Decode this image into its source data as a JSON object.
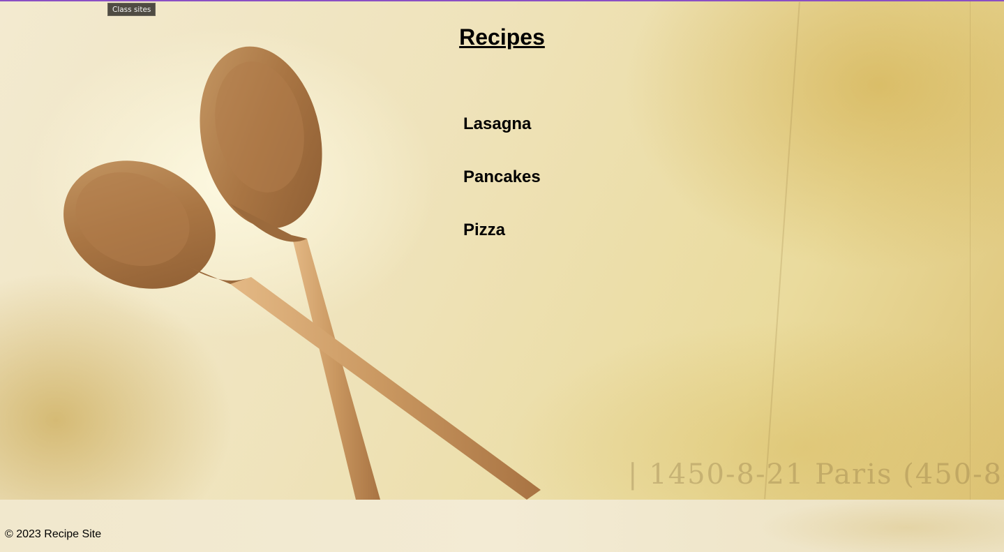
{
  "header": {
    "class_sites_label": "Class sites",
    "title": "Recipes"
  },
  "recipes": [
    {
      "label": "Lasagna"
    },
    {
      "label": "Pancakes"
    },
    {
      "label": "Pizza"
    }
  ],
  "hero": {
    "stamp_text": "| 1450-8-21  Paris (450-8-"
  },
  "footer": {
    "copyright": "© 2023 Recipe Site"
  },
  "colors": {
    "top_accent": "#8a4fc4",
    "background": "#efe3b5",
    "text": "#000000",
    "class_sites_bg": "#4f4b43"
  }
}
